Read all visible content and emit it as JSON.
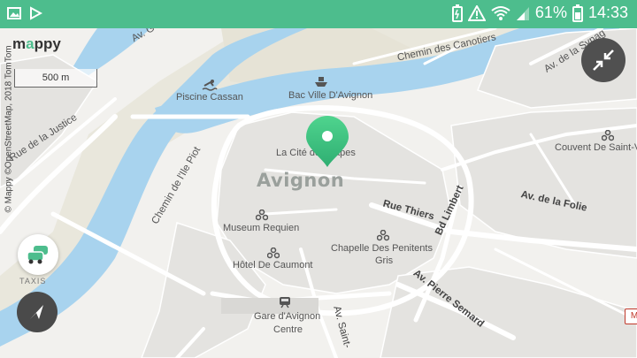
{
  "status_bar": {
    "battery_percent": "61%",
    "time": "14:33",
    "icons": [
      "image-icon",
      "play-store-icon",
      "battery-charging-icon",
      "alert-icon",
      "wifi-icon",
      "signal-icon",
      "battery-icon"
    ]
  },
  "map": {
    "logo": {
      "part1": "m",
      "accent": "a",
      "part2": "ppy"
    },
    "scale_label": "500 m",
    "attribution": "© Mappy ©OpenStreetMap, 2018 TomTom",
    "city_label": "Avignon",
    "roads": {
      "chemin_canotiers": "Chemin des Canotiers",
      "av_synagogue_top": "Av. de la Synag",
      "av_top_left": "Av. G",
      "rue_justice": "Rue de la Justice",
      "chemin_ile_piot": "Chemin de l'Ile Piot",
      "rue_thiers": "Rue Thiers",
      "bd_limbert": "Bd Limbert",
      "av_folie": "Av. de la Folie",
      "av_pierre_semard": "Av. Pierre Semard",
      "av_saint": "Av. Saint-"
    },
    "pois": {
      "piscine_cassan": "Piscine Cassan",
      "bac_ville": "Bac Ville D'Avignon",
      "cite_papes": "La Cité des Papes",
      "museum_requien": "Museum Requien",
      "hotel_caumont": "Hôtel De Caumont",
      "chapelle_line1": "Chapelle Des Penitents",
      "chapelle_line2": "Gris",
      "gare_line1": "Gare d'Avignon",
      "gare_line2": "Centre",
      "couvent": "Couvent De Saint-V"
    },
    "taxi_label": "TAXIS",
    "edge_sign": "M",
    "colors": {
      "water": "#a8d3ee",
      "parks": "#e8e6d9",
      "roads": "#ffffff",
      "accent": "#4dbd8d",
      "pin": "#3cc07e"
    }
  }
}
